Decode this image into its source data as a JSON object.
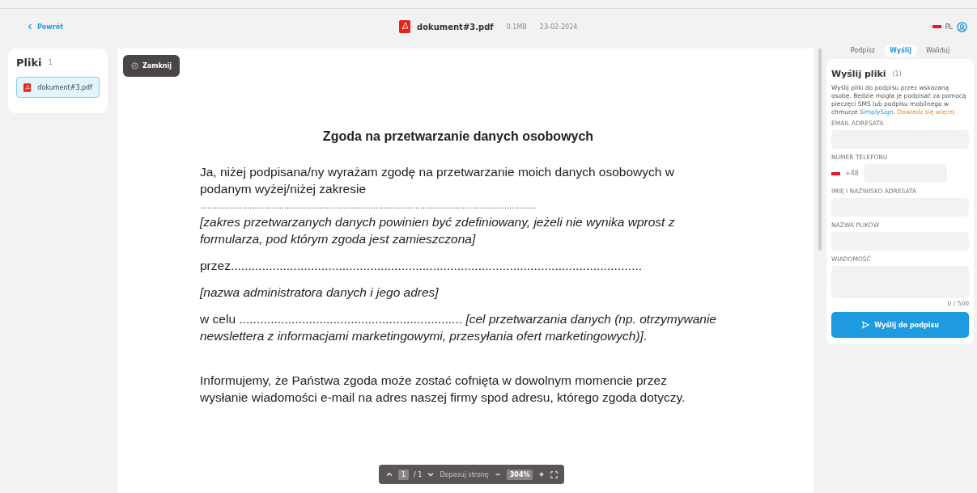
{
  "header": {
    "back": "Powrót",
    "file_name": "dokument#3.pdf",
    "file_size": "0.1MB",
    "date": "23-02-2024",
    "language": "PL"
  },
  "sidebar": {
    "title": "Pliki",
    "count": "1",
    "files": [
      {
        "name": "dokument#3.pdf",
        "selected": true
      }
    ]
  },
  "viewer": {
    "close": "Zamknij",
    "title": "Zgoda na przetwarzanie danych osobowych",
    "paragraphs": [
      {
        "kind": "normal",
        "text": "Ja, niżej podpisana/ny wyrażam zgodę na przetwarzanie moich danych osobowych w podanym wyżej/niżej zakresie"
      },
      {
        "kind": "dots",
        "text": "........................................................................................................................................"
      },
      {
        "kind": "italic",
        "text": "[zakres przetwarzanych danych powinien być zdefiniowany, jeżeli nie wynika wprost z formularza, pod którym zgoda jest zamieszczona]"
      },
      {
        "kind": "normal",
        "text": "przez......................................................................................................................"
      },
      {
        "kind": "italic",
        "text": "[nazwa administratora danych i jego adres]"
      },
      {
        "kind": "justified",
        "text": "w celu ................................................................ *[cel przetwarzania danych (np. otrzymywanie newslettera z informacjami marketingowymi, przesyłania ofert marketingowych)]*."
      },
      {
        "kind": "normal",
        "text": "Informujemy, że Państwa zgoda może zostać cofnięta w dowolnym momencie przez wysłanie wiadomości e-mail na adres naszej firmy spod adresu, którego zgoda dotyczy."
      }
    ],
    "toolbar": {
      "page": "1",
      "total": "/ 1",
      "fit": "Dopasuj stronę",
      "zoom": "304%"
    }
  },
  "panel": {
    "tabs": [
      {
        "label": "Podpisz",
        "selected": false
      },
      {
        "label": "Wyślij",
        "selected": true
      },
      {
        "label": "Waliduj",
        "selected": false
      }
    ],
    "title": "Wyślij pliki",
    "count": "(1)",
    "description": "Wyślij pliki do podpisu przez wskazaną osobę. Będzie mogła je podpisać za pomocą pieczęci SMS lub podpisu mobilnego w chmurze",
    "link_brand": "SimplySign.",
    "link_more": "Dowiedz się więcej",
    "fields": [
      {
        "kind": "text",
        "label": "EMAIL ADRESATA"
      },
      {
        "kind": "phone",
        "label": "NUMER TELEFONU",
        "prefix": "+48"
      },
      {
        "kind": "text",
        "label": "IMIĘ I NAZWISKO ADRESATA"
      },
      {
        "kind": "text",
        "label": "NAZWA PLIKÓW"
      },
      {
        "kind": "textarea",
        "label": "WIADOMOŚĆ",
        "counter": "0 / 500"
      }
    ],
    "submit": "Wyślij do podpisu"
  }
}
